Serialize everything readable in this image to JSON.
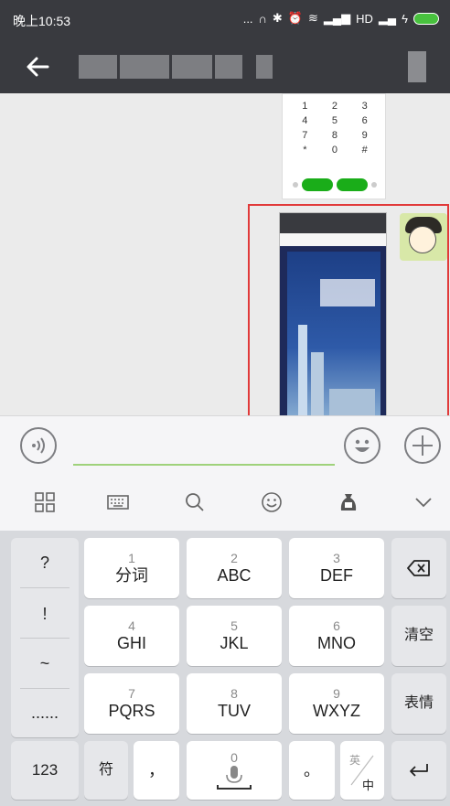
{
  "status_bar": {
    "time": "晚上10:53",
    "network": "HD",
    "dots": "..."
  },
  "chat": {
    "dialpad": {
      "keys": [
        "1",
        "2",
        "3",
        "4",
        "5",
        "6",
        "7",
        "8",
        "9",
        "*",
        "0",
        "#"
      ]
    }
  },
  "input_bar": {},
  "keyboard": {
    "side_keys": [
      "?",
      "!",
      "~",
      "......"
    ],
    "rows": [
      [
        {
          "num": "1",
          "label": "分词"
        },
        {
          "num": "2",
          "label": "ABC"
        },
        {
          "num": "3",
          "label": "DEF"
        }
      ],
      [
        {
          "num": "4",
          "label": "GHI"
        },
        {
          "num": "5",
          "label": "JKL"
        },
        {
          "num": "6",
          "label": "MNO"
        }
      ],
      [
        {
          "num": "7",
          "label": "PQRS"
        },
        {
          "num": "8",
          "label": "TUV"
        },
        {
          "num": "9",
          "label": "WXYZ"
        }
      ]
    ],
    "right_keys": {
      "clear": "清空",
      "emoji": "表情"
    },
    "bottom": {
      "num_mode": "123",
      "symbols": "符",
      "comma": "，",
      "space_num": "0",
      "period": "。",
      "lang_en": "英",
      "lang_zh": "中"
    }
  },
  "colors": {
    "titlebar": "#393a3f",
    "accent_green": "#1aad19",
    "highlight_red": "#e13a3a"
  }
}
